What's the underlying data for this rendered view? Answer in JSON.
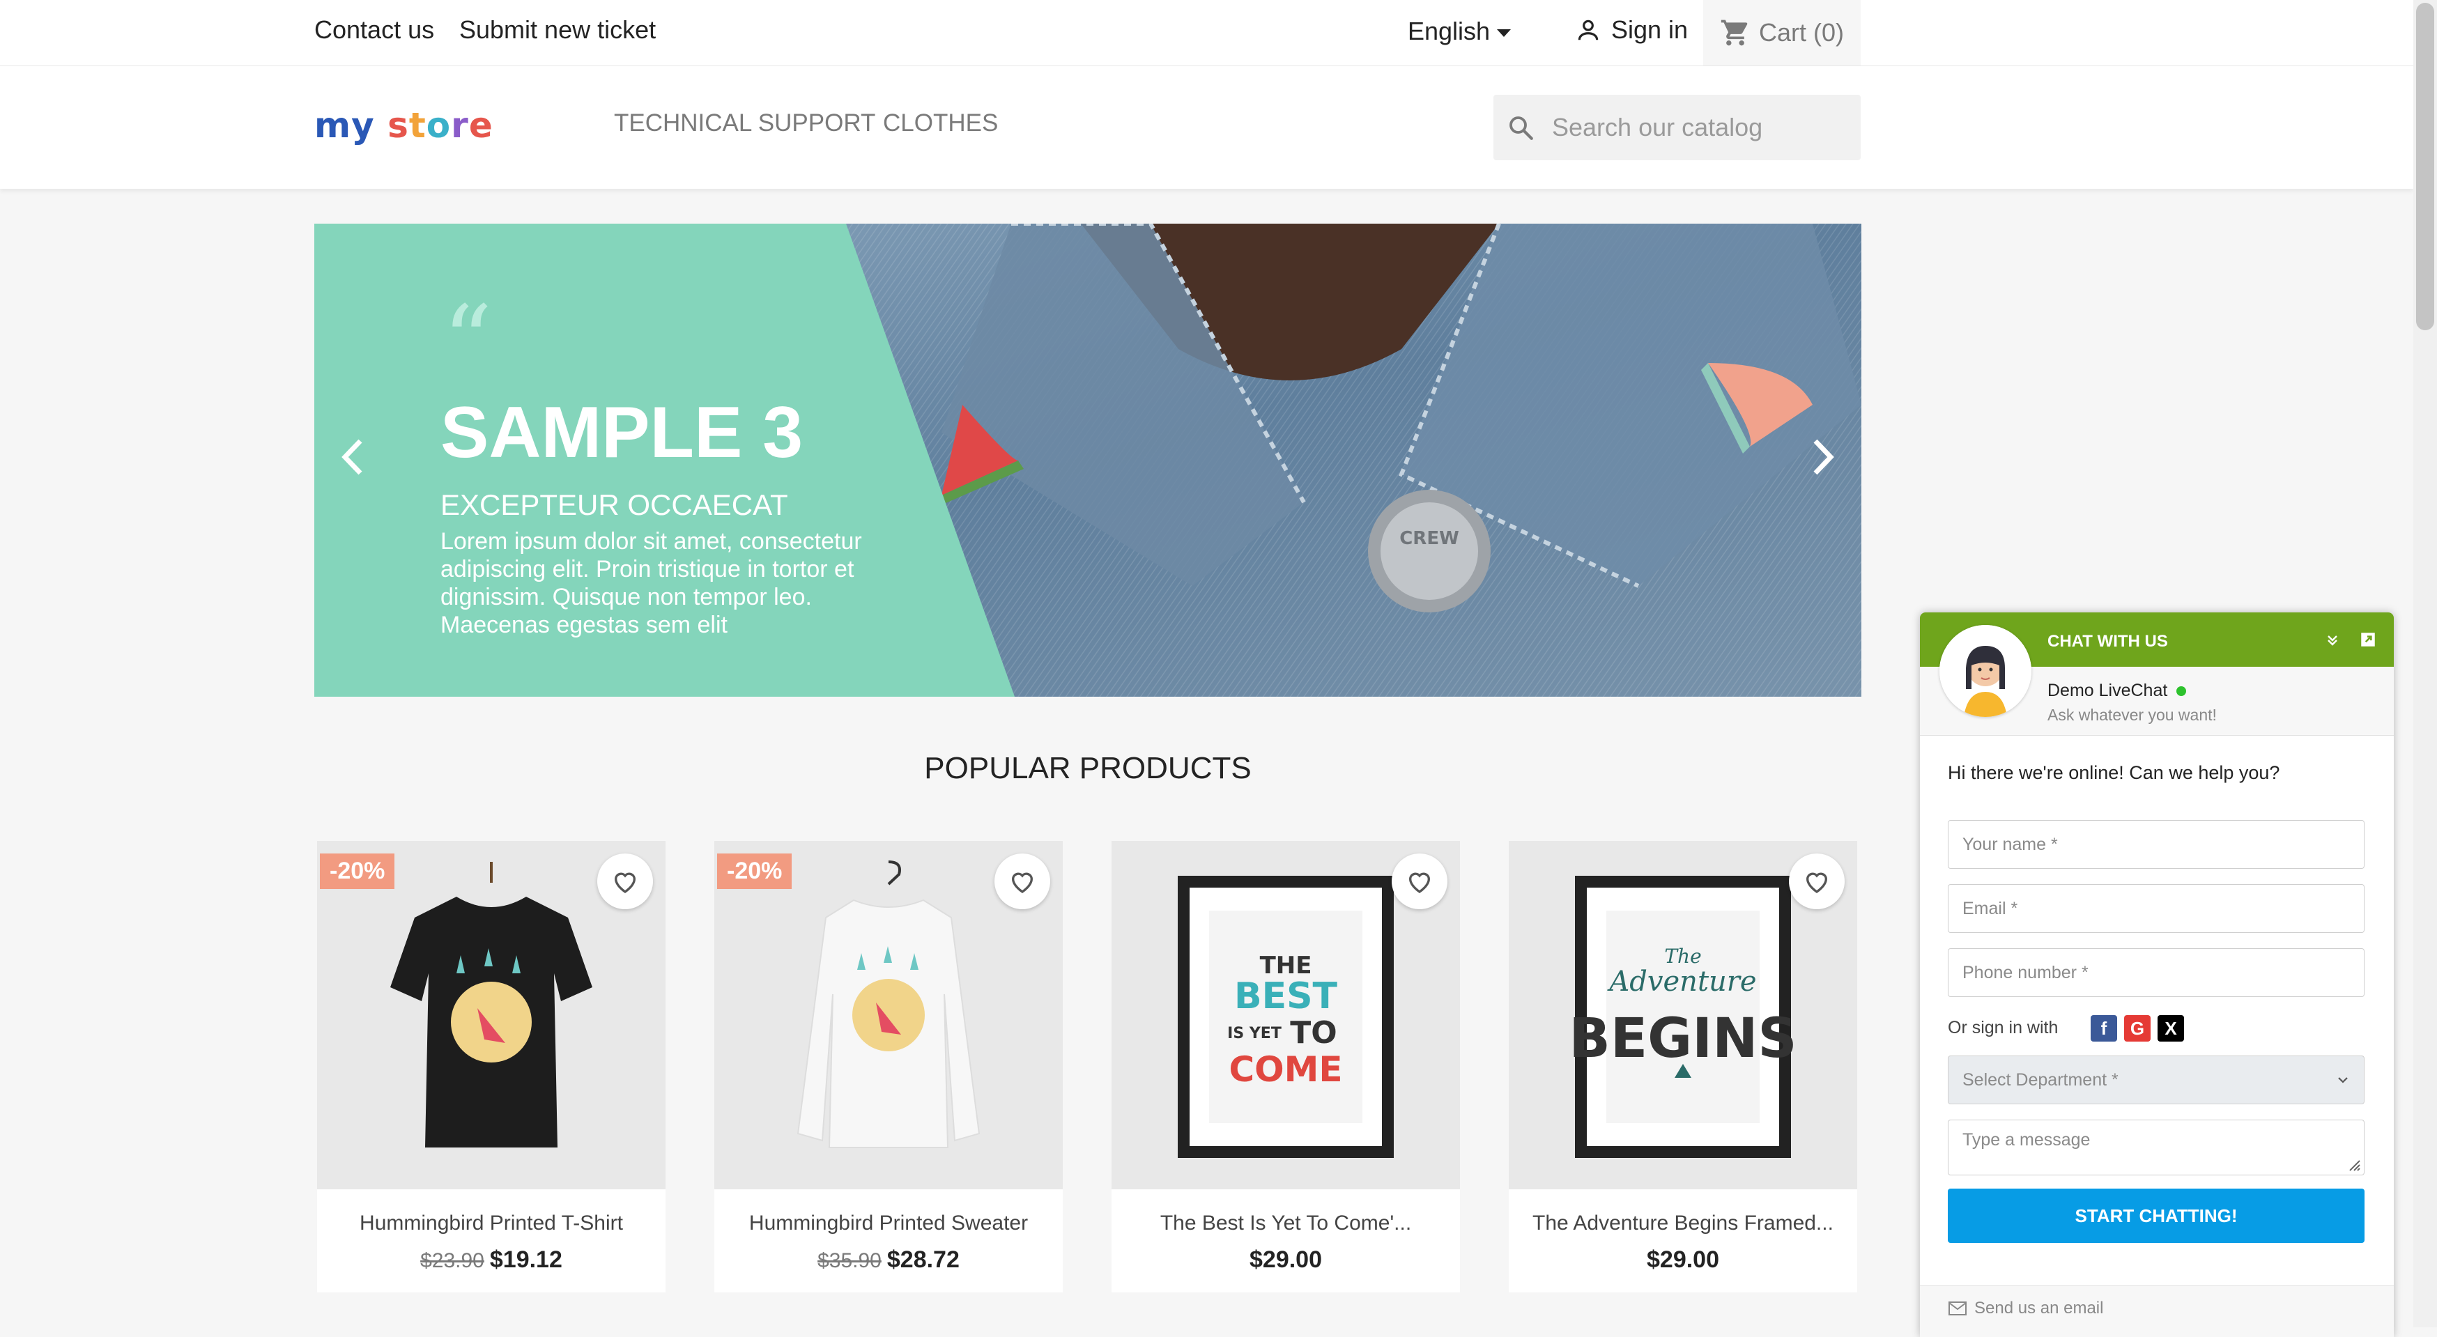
{
  "topbar": {
    "contact_label": "Contact us",
    "ticket_label": "Submit new ticket",
    "language": "English",
    "signin_label": "Sign in",
    "cart_label": "Cart (0)"
  },
  "header": {
    "logo": {
      "part1": "my",
      "part2_letters": [
        "s",
        "t",
        "o",
        "r",
        "e"
      ]
    },
    "nav": [
      "TECHNICAL SUPPORT",
      "CLOTHES"
    ],
    "search_placeholder": "Search our catalog"
  },
  "slider": {
    "quote_mark": "“",
    "title": "SAMPLE 3",
    "subtitle": "EXCEPTEUR OCCAECAT",
    "description": "Lorem ipsum dolor sit amet, consectetur adipiscing elit. Proin tristique in tortor et dignissim. Quisque non tempor leo. Maecenas egestas sem elit",
    "accent_color": "#84d5bb"
  },
  "popular": {
    "title": "POPULAR PRODUCTS",
    "products": [
      {
        "name": "Hummingbird Printed T-Shirt",
        "discount": "-20%",
        "old_price": "$23.90",
        "price": "$19.12"
      },
      {
        "name": "Hummingbird Printed Sweater",
        "discount": "-20%",
        "old_price": "$35.90",
        "price": "$28.72"
      },
      {
        "name": "The Best Is Yet To Come'...",
        "discount": "",
        "old_price": "",
        "price": "$29.00"
      },
      {
        "name": "The Adventure Begins Framed...",
        "discount": "",
        "old_price": "",
        "price": "$29.00"
      }
    ]
  },
  "poster_text": {
    "best": [
      "THE",
      "BEST",
      "IS YET",
      "TO",
      "COME"
    ],
    "adventure": [
      "The",
      "Adventure",
      "BEGINS"
    ]
  },
  "denim_button_text": "CREW",
  "chat": {
    "header_title": "CHAT WITH US",
    "header_color": "#6fa51c",
    "agent_name": "Demo LiveChat",
    "agent_subtitle": "Ask whatever you want!",
    "greeting": "Hi there we're online! Can we help you?",
    "name_placeholder": "Your name *",
    "email_placeholder": "Email *",
    "phone_placeholder": "Phone number *",
    "or_sign_in": "Or sign in with",
    "social": [
      "f",
      "G",
      "X"
    ],
    "department_placeholder": "Select Department *",
    "message_placeholder": "Type a message",
    "start_button": "START CHATTING!",
    "button_color": "#079ce5",
    "footer_link": "Send us an email"
  }
}
